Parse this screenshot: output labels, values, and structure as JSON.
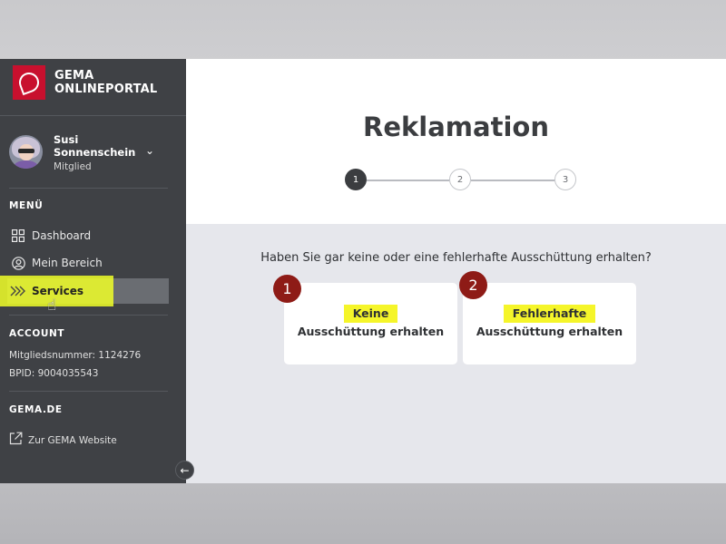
{
  "brand": {
    "line1": "GEMA",
    "line2": "ONLINEPORTAL"
  },
  "user": {
    "first_name": "Susi",
    "last_name": "Sonnenschein",
    "role": "Mitglied"
  },
  "sidebar": {
    "menu_label": "MENÜ",
    "items": [
      {
        "label": "Dashboard",
        "icon": "grid-icon"
      },
      {
        "label": "Mein Bereich",
        "icon": "user-circle-icon"
      },
      {
        "label": "Services",
        "icon": "double-chevron-icon",
        "active": true
      }
    ],
    "account_label": "ACCOUNT",
    "account_lines": [
      "Mitgliedsnummer: 1124276",
      "BPID: 9004035543"
    ],
    "gema_label": "GEMA.DE",
    "website_link": "Zur GEMA Website"
  },
  "main": {
    "title": "Reklamation",
    "steps": [
      "1",
      "2",
      "3"
    ],
    "current_step": 1,
    "question": "Haben Sie gar keine oder eine fehlerhafte Ausschüttung erhalten?",
    "options": [
      {
        "badge": "1",
        "line1": "Keine",
        "line2": "Ausschüttung erhalten"
      },
      {
        "badge": "2",
        "line1": "Fehlerhafte",
        "line2": "Ausschüttung erhalten"
      }
    ]
  },
  "colors": {
    "sidebar_bg": "#3f4145",
    "brand_red": "#c8102e",
    "highlight_yellow": "#f5f52a",
    "badge_red": "#8e1b16",
    "main_bg": "#e6e7ec"
  }
}
